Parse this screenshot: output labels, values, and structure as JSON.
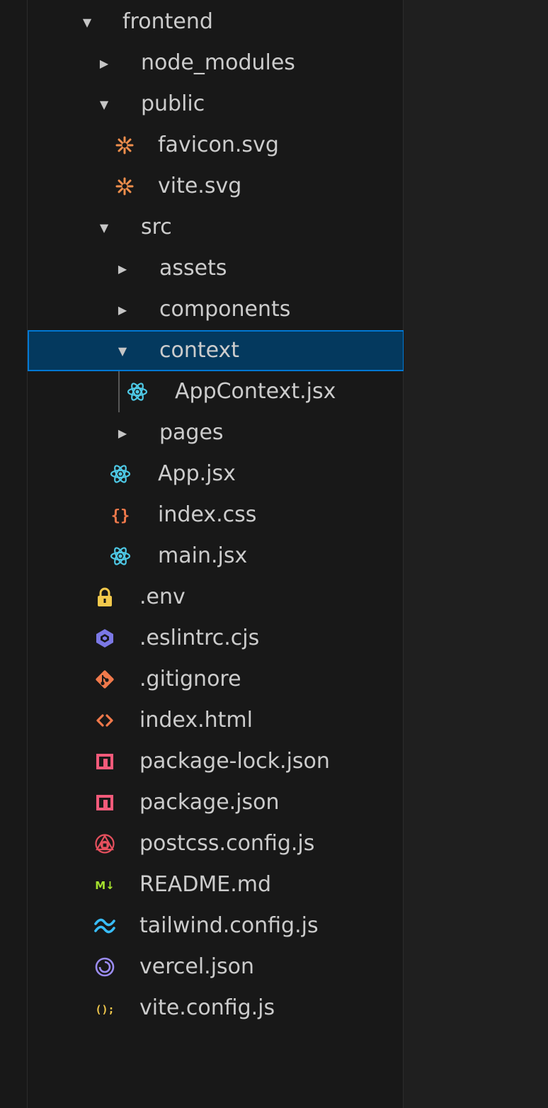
{
  "explorer": {
    "items": [
      {
        "label": "frontend",
        "kind": "folder",
        "expanded": true,
        "icon": "chevron-down-icon"
      },
      {
        "label": "node_modules",
        "kind": "folder",
        "expanded": false,
        "icon": "chevron-right-icon"
      },
      {
        "label": "public",
        "kind": "folder",
        "expanded": true,
        "icon": "chevron-down-icon"
      },
      {
        "label": "favicon.svg",
        "kind": "file",
        "icon": "svg-file-icon",
        "color": "#f18f4d"
      },
      {
        "label": "vite.svg",
        "kind": "file",
        "icon": "svg-file-icon",
        "color": "#f18f4d"
      },
      {
        "label": "src",
        "kind": "folder",
        "expanded": true,
        "icon": "chevron-down-icon"
      },
      {
        "label": "assets",
        "kind": "folder",
        "expanded": false,
        "icon": "chevron-right-icon"
      },
      {
        "label": "components",
        "kind": "folder",
        "expanded": false,
        "icon": "chevron-right-icon"
      },
      {
        "label": "context",
        "kind": "folder",
        "expanded": true,
        "selected": true,
        "icon": "chevron-down-icon"
      },
      {
        "label": "AppContext.jsx",
        "kind": "file",
        "icon": "react-icon",
        "color": "#4ec9e6"
      },
      {
        "label": "pages",
        "kind": "folder",
        "expanded": false,
        "icon": "chevron-right-icon"
      },
      {
        "label": "App.jsx",
        "kind": "file",
        "icon": "react-icon",
        "color": "#4ec9e6"
      },
      {
        "label": "index.css",
        "kind": "file",
        "icon": "css-braces-icon",
        "color": "#f0794b"
      },
      {
        "label": "main.jsx",
        "kind": "file",
        "icon": "react-icon",
        "color": "#4ec9e6"
      },
      {
        "label": ".env",
        "kind": "file",
        "icon": "lock-icon",
        "color": "#f2c94c"
      },
      {
        "label": ".eslintrc.cjs",
        "kind": "file",
        "icon": "eslint-icon",
        "color": "#7b78e5"
      },
      {
        "label": ".gitignore",
        "kind": "file",
        "icon": "git-icon",
        "color": "#f0794b"
      },
      {
        "label": "index.html",
        "kind": "file",
        "icon": "html-icon",
        "color": "#f0794b"
      },
      {
        "label": "package-lock.json",
        "kind": "file",
        "icon": "npm-icon",
        "color": "#f25a7a"
      },
      {
        "label": "package.json",
        "kind": "file",
        "icon": "npm-icon",
        "color": "#f25a7a"
      },
      {
        "label": "postcss.config.js",
        "kind": "file",
        "icon": "postcss-icon",
        "color": "#e6505e"
      },
      {
        "label": "README.md",
        "kind": "file",
        "icon": "markdown-icon",
        "color": "#a6e22e",
        "icon_text": "M↓"
      },
      {
        "label": "tailwind.config.js",
        "kind": "file",
        "icon": "tailwind-icon",
        "color": "#38bdf8"
      },
      {
        "label": "vercel.json",
        "kind": "file",
        "icon": "vercel-icon",
        "color": "#9b8cf2"
      },
      {
        "label": "vite.config.js",
        "kind": "file",
        "icon": "js-config-icon",
        "color": "#f2c94c",
        "icon_text": "();"
      }
    ]
  },
  "colors": {
    "background": "#181818",
    "selection_bg": "#04395e",
    "selection_border": "#0078d4",
    "text": "#cccccc"
  }
}
